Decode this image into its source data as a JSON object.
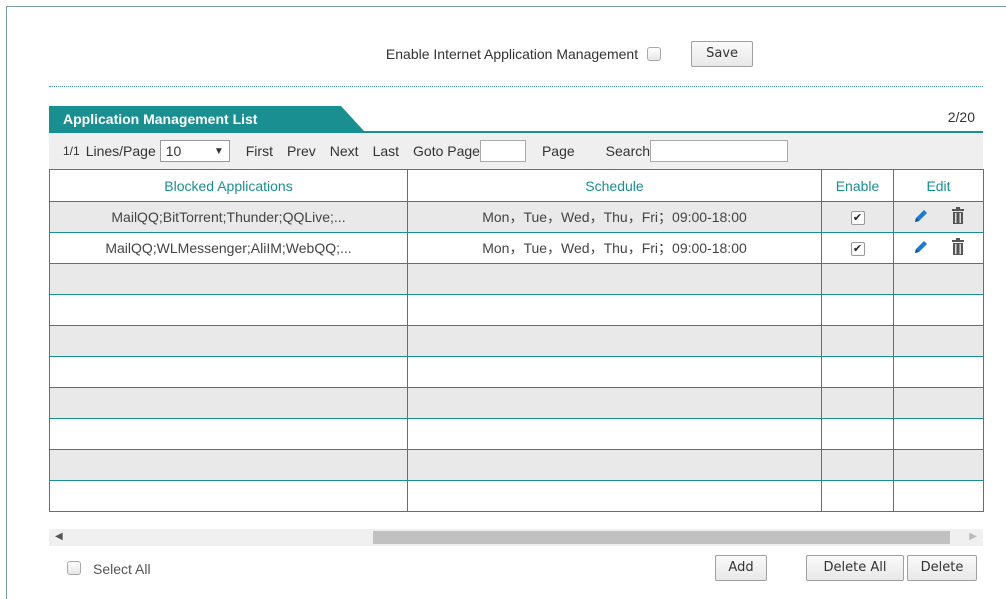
{
  "header": {
    "enable_label": "Enable Internet Application Management",
    "save_label": "Save"
  },
  "list": {
    "tab_title": "Application Management List",
    "count": "2/20",
    "accent_color": "#1a8f92"
  },
  "toolbar": {
    "page_indicator": "1/1",
    "lines_label": "Lines/Page",
    "lines_value": "10",
    "first": "First",
    "prev": "Prev",
    "next": "Next",
    "last": "Last",
    "goto_label": "Goto Page",
    "goto_value": "",
    "page_label": "Page",
    "search_label": "Search",
    "search_value": ""
  },
  "table": {
    "headers": [
      "Blocked Applications",
      "Schedule",
      "Enable",
      "Edit"
    ],
    "rows": [
      {
        "apps": "MailQQ;BitTorrent;Thunder;QQLive;...",
        "schedule": "Mon，Tue，Wed，Thu，Fri；09:00-18:00",
        "enabled": true
      },
      {
        "apps": "MailQQ;WLMessenger;AliIM;WebQQ;...",
        "schedule": "Mon，Tue，Wed，Thu，Fri；09:00-18:00",
        "enabled": true
      }
    ]
  },
  "footer": {
    "select_all": "Select All",
    "add": "Add",
    "delete_all": "Delete All",
    "delete": "Delete"
  }
}
